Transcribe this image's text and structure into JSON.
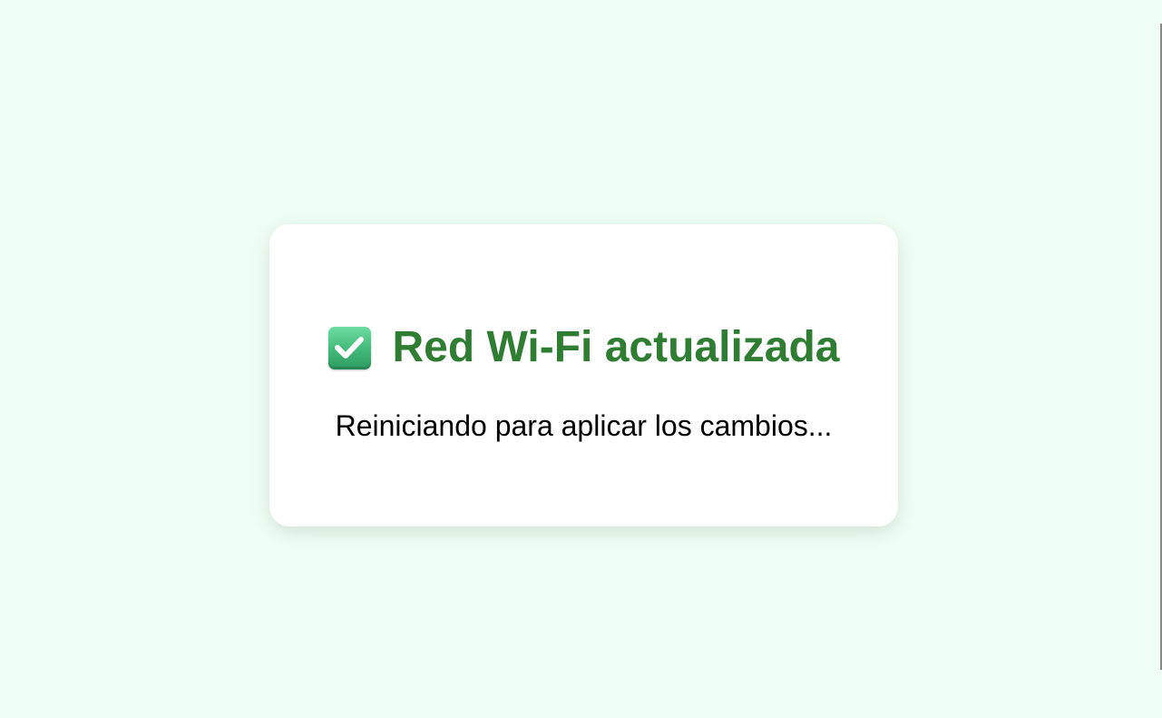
{
  "dialog": {
    "icon": "check-mark-button-icon",
    "title": "Red Wi-Fi actualizada",
    "message": "Reiniciando para aplicar los cambios..."
  },
  "colors": {
    "page_background": "#f0fff3",
    "card_background": "#ffffff",
    "title_color": "#2e7d32",
    "message_color": "#000000",
    "icon_green": "#42b978"
  }
}
